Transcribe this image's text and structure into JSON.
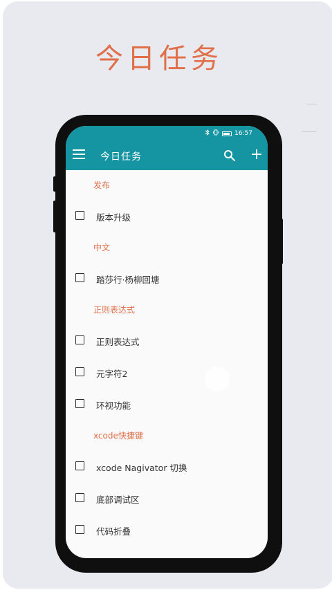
{
  "promo": {
    "title": "今日任务"
  },
  "status_bar": {
    "time": "16:57",
    "icons": [
      "bluetooth-icon",
      "vibrate-icon",
      "battery-icon"
    ]
  },
  "toolbar": {
    "title": "今日任务",
    "menu_icon": "menu-icon",
    "search_icon": "search-icon",
    "add_icon": "add-icon",
    "add_label": "+"
  },
  "colors": {
    "primary": "#1594a1",
    "accent": "#e06f4a",
    "background": "#e9e9f0"
  },
  "sections": [
    {
      "header": "发布",
      "tasks": [
        {
          "label": "版本升级",
          "checked": false
        }
      ]
    },
    {
      "header": "中文",
      "tasks": [
        {
          "label": "踏莎行·杨柳回塘",
          "checked": false
        }
      ]
    },
    {
      "header": "正则表达式",
      "tasks": [
        {
          "label": "正则表达式",
          "checked": false
        },
        {
          "label": "元字符2",
          "checked": false
        },
        {
          "label": "环视功能",
          "checked": false
        }
      ]
    },
    {
      "header": "xcode快捷键",
      "tasks": [
        {
          "label": "xcode Nagivator 切换",
          "checked": false
        },
        {
          "label": "底部调试区",
          "checked": false
        },
        {
          "label": "代码折叠",
          "checked": false
        }
      ]
    }
  ]
}
